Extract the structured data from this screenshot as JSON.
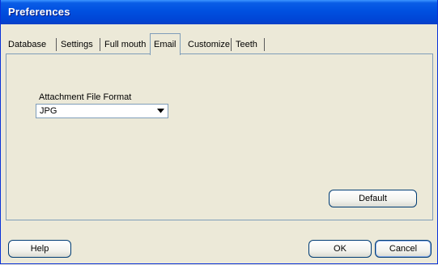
{
  "window": {
    "title": "Preferences"
  },
  "tabs": [
    {
      "label": "Database"
    },
    {
      "label": "Settings"
    },
    {
      "label": "Full mouth"
    },
    {
      "label": "Email",
      "active": true
    },
    {
      "label": "Customize"
    },
    {
      "label": "Teeth"
    }
  ],
  "email": {
    "attachment_format_label": "Attachment File Format",
    "attachment_format_value": "JPG",
    "default_label": "Default"
  },
  "footer": {
    "help_label": "Help",
    "ok_label": "OK",
    "cancel_label": "Cancel"
  },
  "colors": {
    "titlebar": "#0050e0",
    "window_bg": "#ece9d8",
    "button_border": "#003c74"
  },
  "icons": {
    "dropdown": "chevron-down-icon"
  }
}
